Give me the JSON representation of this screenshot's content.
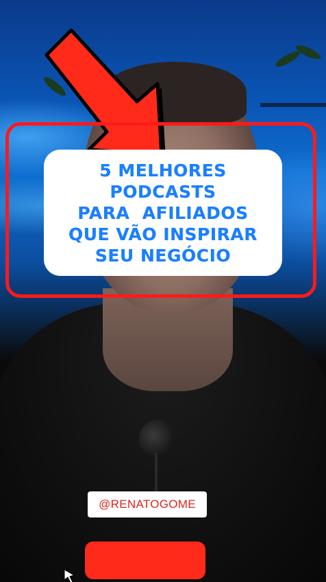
{
  "title_card": {
    "lines": [
      "5 MELHORES",
      "PODCASTS",
      "PARA  AFILIADOS",
      "QUE VÃO INSPIRAR",
      "SEU NEGÓCIO"
    ]
  },
  "handle": {
    "text": "@RENATOGOME"
  },
  "colors": {
    "title_blue": "#1b7fff",
    "frame_red": "#ff1a1a",
    "handle_red": "#e0241d",
    "button_red": "#ff2a1a",
    "background_blue": "#0a56b6"
  },
  "icons": {
    "arrow": "red-arrow-pointing-down-right",
    "microphone": "lapel-mic"
  }
}
